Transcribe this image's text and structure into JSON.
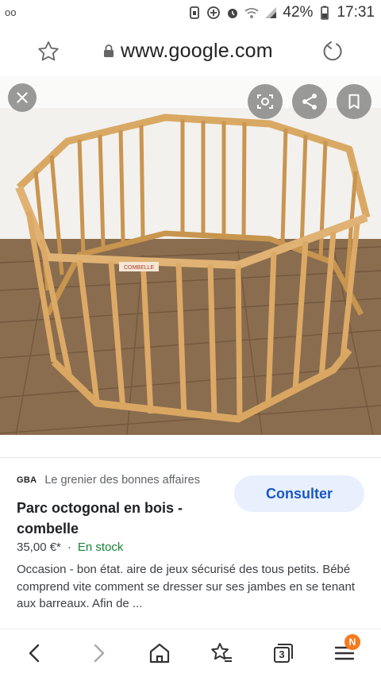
{
  "status_bar": {
    "voicemail": "oo",
    "battery": "42%",
    "time": "17:31"
  },
  "browser": {
    "url": "www.google.com",
    "icons": {
      "star": "star-outline-icon",
      "lock": "lock-icon",
      "reload": "reload-icon"
    }
  },
  "viewer": {
    "icons": [
      "close-icon",
      "lens-icon",
      "share-icon",
      "bookmark-icon"
    ],
    "product_label": "COMBELLE"
  },
  "result": {
    "source_logo": "GBA",
    "source_name": "Le grenier des bonnes affaires",
    "consult_label": "Consulter",
    "title": "Parc octogonal en bois - combelle",
    "price": "35,00 €*",
    "separator": "·",
    "stock": "En stock",
    "description": "Occasion - bon état. aire de jeux sécurisé des tous petits. Bébé comprend vite comment se dresser sur ses jambes en se tenant aux barreaux. Afin de ..."
  },
  "bottom_nav": {
    "tabs_count": "3",
    "menu_badge": "N"
  },
  "colors": {
    "accent": "#1a56c5",
    "button_bg": "#e8f0fe",
    "stock_green": "#188038",
    "badge_orange": "#f47a20"
  }
}
